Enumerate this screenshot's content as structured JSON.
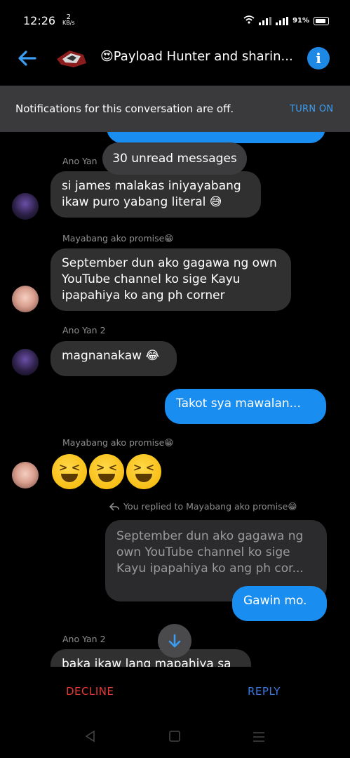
{
  "status": {
    "time": "12:26",
    "speed_value": "2",
    "speed_unit": "KB/s",
    "battery": "91%"
  },
  "header": {
    "title": "😍Payload Hunter and sharin..."
  },
  "notice": {
    "text": "Notifications for this conversation are off.",
    "action": "TURN ON"
  },
  "unread_pill": "30 unread messages",
  "messages": {
    "partial_top": "",
    "m1_sender": "Ano Yan",
    "m1_text": "si james malakas iniyayabang ikaw puro yabang literal 😅",
    "m2_sender": "Mayabang ako promise😁",
    "m2_text": "September dun ako gagawa ng own YouTube channel ko sige Kayu ipapahiya ko ang ph corner",
    "m3_sender": "Ano Yan 2",
    "m3_text": "magnanakaw 😂",
    "m4_text": "Takot sya mawalan...",
    "m5_sender": "Mayabang ako promise😁",
    "m6_reply_label": "You replied to Mayabang ako promise😁",
    "m6_quote": "September dun ako gagawa ng own YouTube channel ko sige Kayu ipapahiya ko ang ph cor...",
    "m6_text": "Gawin mo.",
    "m7_sender": "Ano Yan 2",
    "m7_text": "baka ikaw lang mapahiya sa"
  },
  "actions": {
    "decline": "DECLINE",
    "reply": "REPLY"
  },
  "colors": {
    "accent": "#1a8ef0",
    "decline": "#e53935",
    "incoming": "#303030",
    "notice_bg": "#3a3a3c"
  }
}
